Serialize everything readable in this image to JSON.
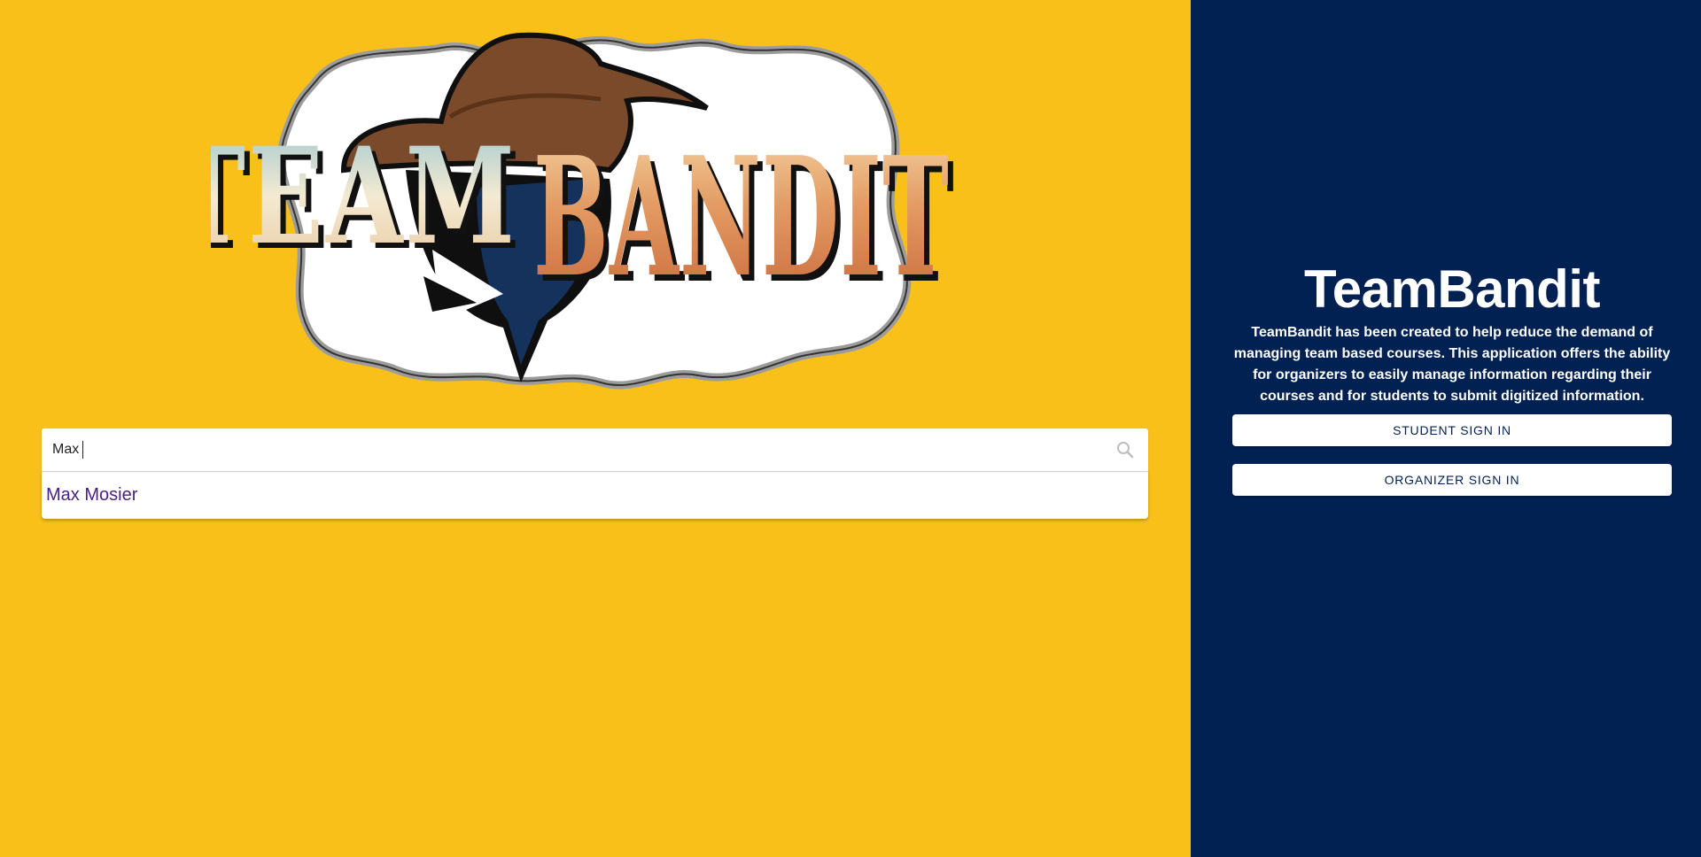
{
  "logo": {
    "text_left": "TEAM",
    "text_right": "BANDIT"
  },
  "search": {
    "value": "Max",
    "placeholder": "",
    "icon": "search-icon",
    "results": [
      {
        "label": "Max Mosier"
      }
    ]
  },
  "panel": {
    "title": "TeamBandit",
    "description": "TeamBandit has been created to help reduce the demand of managing team based courses. This application offers the ability for organizers to easily manage information regarding their courses and for students to submit digitized information.",
    "student_button": "STUDENT SIGN IN",
    "organizer_button": "ORGANIZER SIGN IN"
  },
  "colors": {
    "left_background": "#f9c01a",
    "right_background": "#002152",
    "result_text": "#4b2086",
    "hat_brown": "#7a4a2a"
  }
}
